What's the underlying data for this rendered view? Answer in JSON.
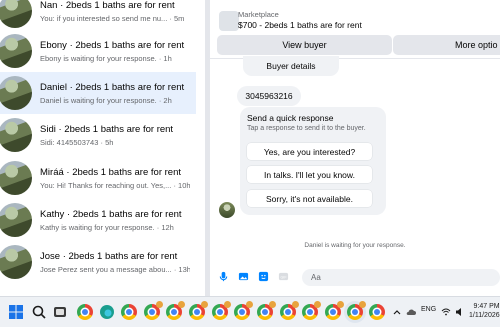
{
  "conversations": [
    {
      "name": "Nan · 2beds 1 baths are for rent",
      "preview": "You: if you interested so send me nu...",
      "time": "· 5m"
    },
    {
      "name": "Ebony · 2beds 1 baths are for rent",
      "preview": "Ebony is waiting for your response.",
      "time": "· 1h"
    },
    {
      "name": "Daniel · 2beds 1 baths are for rent",
      "preview": "Daniel is waiting for your response.",
      "time": "· 2h"
    },
    {
      "name": "Sidi · 2beds 1 baths are for rent",
      "preview": "Sidi: 4145503743",
      "time": "· 5h"
    },
    {
      "name": "Miráá · 2beds 1 baths are for rent",
      "preview": "You: Hi! Thanks for reaching out. Yes,...",
      "time": "· 10h"
    },
    {
      "name": "Kathy · 2beds 1 baths are for rent",
      "preview": "Kathy is waiting for your response.",
      "time": "· 12h"
    },
    {
      "name": "Jose · 2beds 1 baths are for rent",
      "preview": "Jose Perez sent you a message abou...",
      "time": "· 13h"
    }
  ],
  "header": {
    "label": "Marketplace",
    "title": "$700 - 2beds 1 baths are for rent",
    "view_buyer": "View buyer",
    "more_options": "More optio"
  },
  "chat": {
    "buyer_details": "Buyer details",
    "phone": "3045963216",
    "quick_title": "Send a quick response",
    "quick_sub": "Tap a response to send it to the buyer.",
    "responses": [
      "Yes, are you interested?",
      "In talks. I'll let you know.",
      "Sorry, it's not available."
    ],
    "waiting": "Daniel is waiting for your response."
  },
  "composer": {
    "placeholder": "Aa"
  },
  "taskbar": {
    "lang": "ENG",
    "time": "9:47 PM",
    "date": "1/11/2026"
  },
  "colors": {
    "accent": "#0084ff",
    "selected_bg": "#e7f0fd",
    "bubble_bg": "#f0f2f5"
  }
}
